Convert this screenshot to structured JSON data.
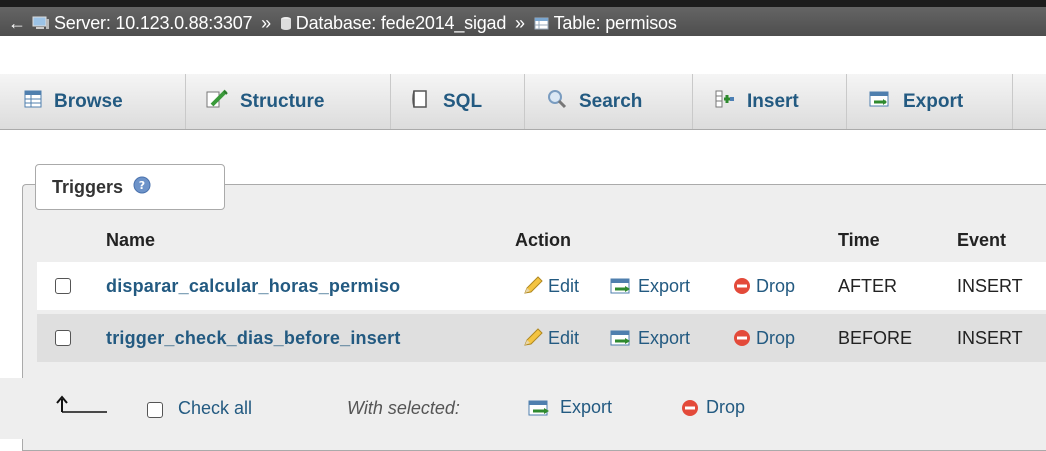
{
  "breadcrumb": {
    "back_icon": "arrow-left-icon",
    "server": "Server: 10.123.0.88:3307",
    "database": "Database: fede2014_sigad",
    "table": "Table: permisos",
    "separator": "»"
  },
  "tabs": [
    {
      "label": "Browse",
      "icon": "browse-icon"
    },
    {
      "label": "Structure",
      "icon": "structure-icon"
    },
    {
      "label": "SQL",
      "icon": "sql-icon"
    },
    {
      "label": "Search",
      "icon": "search-icon"
    },
    {
      "label": "Insert",
      "icon": "insert-icon"
    },
    {
      "label": "Export",
      "icon": "export-icon"
    }
  ],
  "triggers": {
    "legend": "Triggers",
    "columns": {
      "name": "Name",
      "action": "Action",
      "time": "Time",
      "event": "Event"
    },
    "actions": {
      "edit": "Edit",
      "export": "Export",
      "drop": "Drop"
    },
    "rows": [
      {
        "name": "disparar_calcular_horas_permiso",
        "time": "AFTER",
        "event": "INSERT"
      },
      {
        "name": "trigger_check_dias_before_insert",
        "time": "BEFORE",
        "event": "INSERT"
      }
    ]
  },
  "footer": {
    "check_all": "Check all",
    "with_selected": "With selected:",
    "export": "Export",
    "drop": "Drop"
  },
  "colors": {
    "link": "#235a81",
    "topbar": "#555555",
    "row_alt": "#dfdfdf"
  }
}
